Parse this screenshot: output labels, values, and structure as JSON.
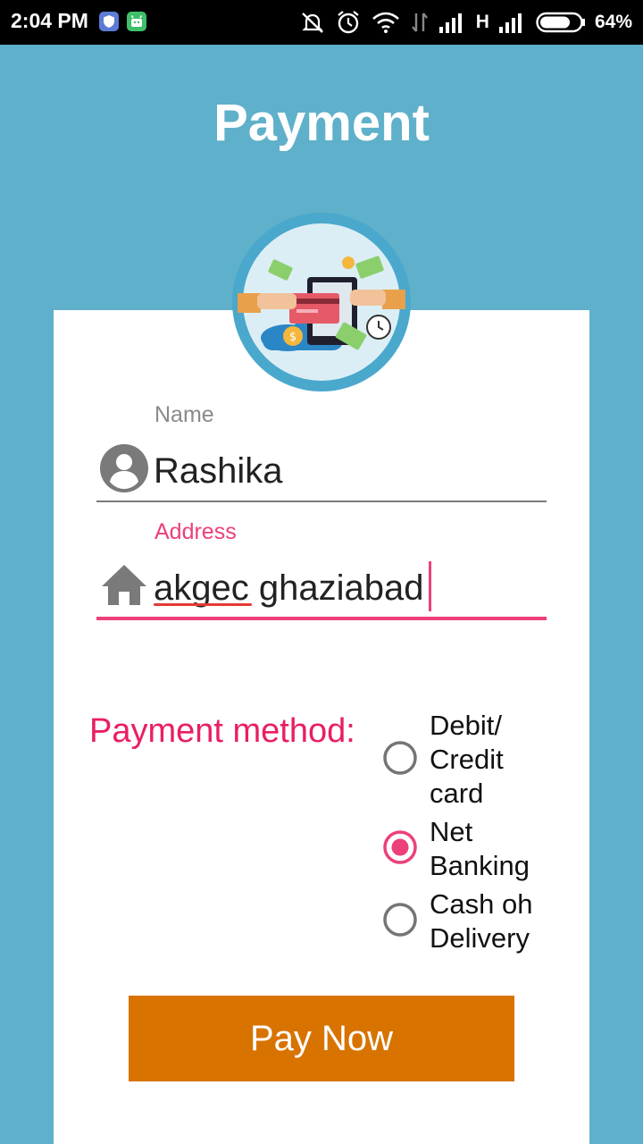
{
  "status_bar": {
    "time": "2:04 PM",
    "network": "H",
    "battery": "64%",
    "icons": [
      "shield-app-icon",
      "android-app-icon",
      "mute-icon",
      "alarm-icon",
      "wifi-icon",
      "data-arrows-icon",
      "signal-icon",
      "battery-icon"
    ]
  },
  "header": {
    "title": "Payment"
  },
  "form": {
    "name_label": "Name",
    "name_value": "Rashika",
    "name_icon": "person-icon",
    "address_label": "Address",
    "address_value": "akgec ghaziabad",
    "address_icon": "home-icon"
  },
  "payment": {
    "label": "Payment method:",
    "options": [
      {
        "label": "Debit/\nCredit\ncard",
        "selected": false
      },
      {
        "label": "Net\nBanking",
        "selected": true
      },
      {
        "label": "Cash oh\nDelivery",
        "selected": false
      }
    ]
  },
  "button": {
    "label": "Pay Now"
  },
  "colors": {
    "background": "#5fb0ca",
    "accent": "#ec407a",
    "button": "#d87300"
  }
}
